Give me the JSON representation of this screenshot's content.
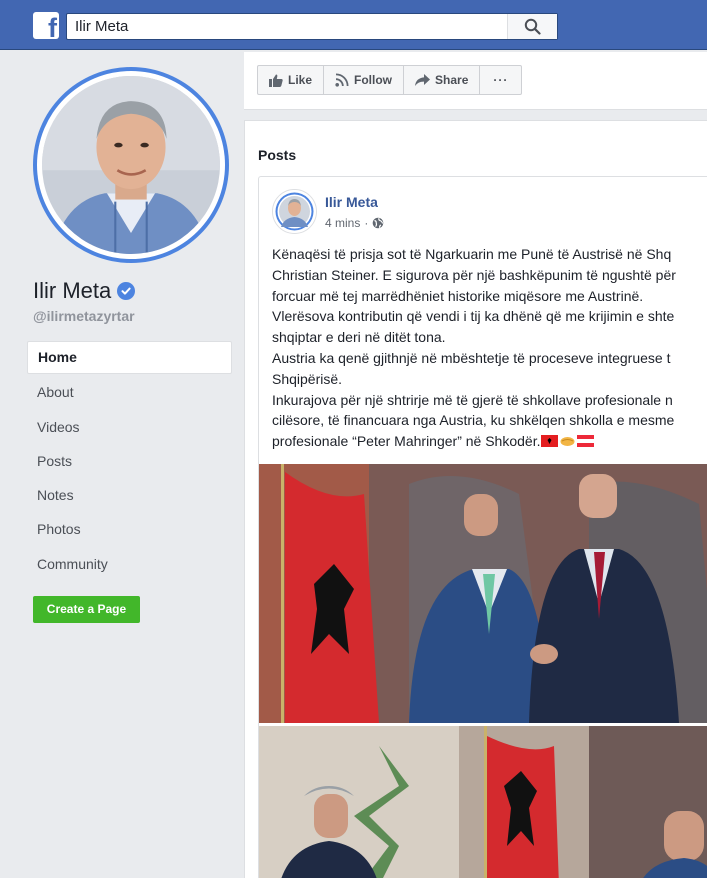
{
  "topbar": {
    "search_value": "Ilir Meta",
    "logo_letter": "f",
    "colors": {
      "bar": "#4267b2",
      "bar_border": "#29487d"
    }
  },
  "sidebar": {
    "page_name": "Ilir Meta",
    "handle": "@ilirmetazyrtar",
    "nav": [
      {
        "label": "Home",
        "active": true
      },
      {
        "label": "About"
      },
      {
        "label": "Videos"
      },
      {
        "label": "Posts"
      },
      {
        "label": "Notes"
      },
      {
        "label": "Photos"
      },
      {
        "label": "Community"
      }
    ],
    "create_page_label": "Create a Page"
  },
  "actions": {
    "like_label": "Like",
    "follow_label": "Follow",
    "share_label": "Share",
    "more_label": "···"
  },
  "posts": {
    "section_title": "Posts",
    "post": {
      "author": "Ilir Meta",
      "time": "4 mins",
      "audience_icon": "globe-icon",
      "lines": [
        "Kënaqësi të prisja sot të Ngarkuarin me Punë të Austrisë në Shq",
        "Christian Steiner. E sigurova për një bashkëpunim të ngushtë për",
        "forcuar më tej marrëdhëniet historike miqësore me Austrinë.",
        "Vlerësova kontributin që vendi i tij ka dhënë që me krijimin e shte",
        "shqiptar e deri në ditët tona.",
        "Austria ka qenë gjithnjë në mbështetje të proceseve integruese t",
        "Shqipërisë.",
        "Inkurajova për një shtrirje më të gjerë të shkollave profesionale n",
        "cilësore, të financuara nga Austria, ku shkëlqen shkolla e mesme",
        "profesionale “Peter Mahringer” në Shkodër."
      ],
      "emoji": [
        "albania-flag-icon",
        "handshake-icon",
        "austria-flag-icon"
      ]
    }
  },
  "colors": {
    "link": "#385898",
    "accent_blue": "#4d84e0",
    "create_green": "#42b72a",
    "page_bg": "#e9ebee"
  }
}
